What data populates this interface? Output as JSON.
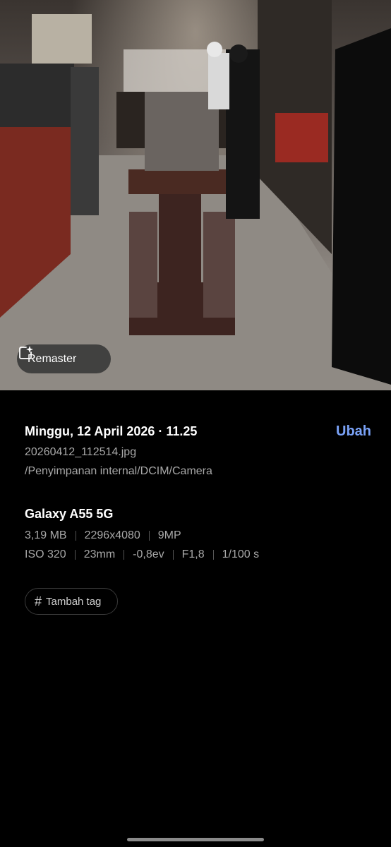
{
  "photo": {
    "remaster_label": "Remaster",
    "remaster_icon": "sparkle-image-icon"
  },
  "details": {
    "date_time": "Minggu, 12 April 2026 · 11.25",
    "edit_label": "Ubah",
    "filename": "20260412_112514.jpg",
    "path": "/Penyimpanan internal/DCIM/Camera",
    "device": "Galaxy A55 5G",
    "file_info": [
      "3,19 MB",
      "2296x4080",
      "9MP"
    ],
    "camera_info": [
      "ISO 320",
      "23mm",
      "-0,8ev",
      "F1,8",
      "1/100 s"
    ]
  },
  "tags": {
    "add_tag_label": "Tambah tag",
    "hash_icon": "hash-icon"
  },
  "colors": {
    "accent": "#7aa2f7",
    "secondary_text": "#a8a8a8",
    "background": "#000000"
  }
}
